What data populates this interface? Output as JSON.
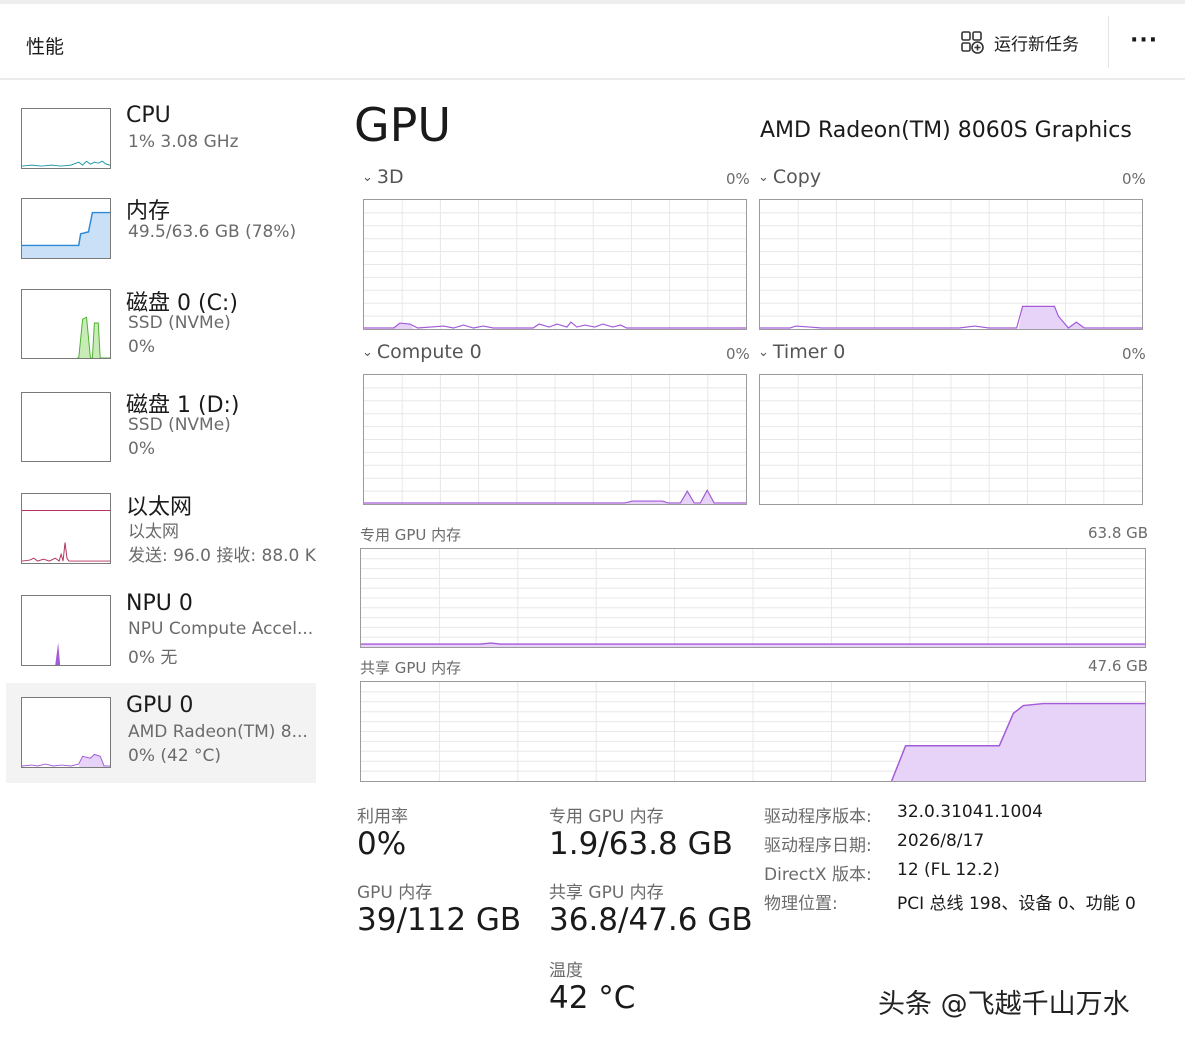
{
  "header": {
    "title": "性能",
    "run_task_label": "运行新任务",
    "more_label": "···"
  },
  "sidebar": {
    "items": [
      {
        "name": "CPU",
        "sub1": "1% 3.08 GHz",
        "sub2": ""
      },
      {
        "name": "内存",
        "sub1": "49.5/63.6 GB (78%)",
        "sub2": ""
      },
      {
        "name": "磁盘 0 (C:)",
        "sub1": "SSD (NVMe)",
        "sub2": "0%"
      },
      {
        "name": "磁盘 1 (D:)",
        "sub1": "SSD (NVMe)",
        "sub2": "0%"
      },
      {
        "name": "以太网",
        "sub1": "以太网",
        "sub2": "发送: 96.0 接收: 88.0 K"
      },
      {
        "name": "NPU 0",
        "sub1": "NPU Compute Accel...",
        "sub2": "0% 无"
      },
      {
        "name": "GPU 0",
        "sub1": "AMD Radeon(TM) 8...",
        "sub2": "0% (42 °C)"
      }
    ]
  },
  "main": {
    "title": "GPU",
    "model": "AMD Radeon(TM) 8060S Graphics",
    "engines": [
      {
        "label": "3D",
        "pct": "0%"
      },
      {
        "label": "Copy",
        "pct": "0%"
      },
      {
        "label": "Compute 0",
        "pct": "0%"
      },
      {
        "label": "Timer 0",
        "pct": "0%"
      }
    ],
    "dedicated_mem": {
      "label": "专用 GPU 内存",
      "max": "63.8 GB"
    },
    "shared_mem": {
      "label": "共享 GPU 内存",
      "max": "47.6 GB"
    },
    "stats": {
      "util_label": "利用率",
      "util_value": "0%",
      "gpu_mem_label": "GPU 内存",
      "gpu_mem_value": "39/112 GB",
      "ded_label": "专用 GPU 内存",
      "ded_value": "1.9/63.8 GB",
      "shared_label": "共享 GPU 内存",
      "shared_value": "36.8/47.6 GB",
      "temp_label": "温度",
      "temp_value": "42 °C"
    },
    "info": [
      {
        "label": "驱动程序版本:",
        "value": "32.0.31041.1004"
      },
      {
        "label": "驱动程序日期:",
        "value": "2026/8/17"
      },
      {
        "label": "DirectX 版本:",
        "value": "12 (FL 12.2)"
      },
      {
        "label": "物理位置:",
        "value": "PCI 总线 198、设备 0、功能 0"
      }
    ]
  },
  "watermark": "头条 @飞越千山万水",
  "colors": {
    "gpu": "#a35bd8",
    "gpu_fill": "#e6d3f7",
    "memory": "#2e88d8",
    "memory_fill": "#c9e0f7",
    "disk": "#4caf2e",
    "disk_fill": "#c8ecb8",
    "ethernet": "#b3325f",
    "grid": "#e8e8e8",
    "active_bg": "#f3f3f3"
  }
}
